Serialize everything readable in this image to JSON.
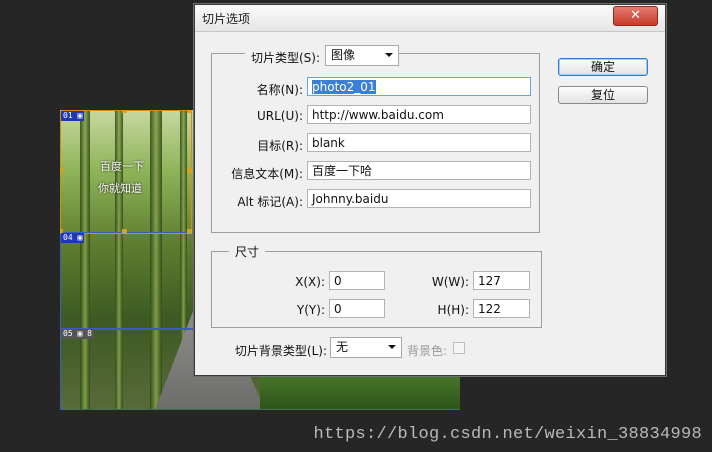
{
  "watermark": "https://blog.csdn.net/weixin_38834998",
  "canvas": {
    "slice_01": "01",
    "slice_04": "04",
    "slice_05": "05",
    "slice_05_num": "8",
    "overlay_line1": "百度一下",
    "overlay_line2": "你就知道"
  },
  "dialog": {
    "title": "切片选项",
    "close_glyph": "✕",
    "slice_type_label": "切片类型(S):",
    "slice_type_value": "图像",
    "fields": {
      "name": {
        "label": "名称(N):",
        "value": "photo2_01"
      },
      "url": {
        "label": "URL(U):",
        "value": "http://www.baidu.com"
      },
      "target": {
        "label": "目标(R):",
        "value": "blank"
      },
      "message": {
        "label": "信息文本(M):",
        "value": "百度一下哈"
      },
      "alt": {
        "label": "Alt 标记(A):",
        "value": "Johnny.baidu"
      }
    },
    "dimensions": {
      "legend": "尺寸",
      "x": {
        "label": "X(X):",
        "value": "0"
      },
      "y": {
        "label": "Y(Y):",
        "value": "0"
      },
      "w": {
        "label": "W(W):",
        "value": "127"
      },
      "h": {
        "label": "H(H):",
        "value": "122"
      }
    },
    "background": {
      "type_label": "切片背景类型(L):",
      "type_value": "无",
      "color_label": "背景色:"
    },
    "buttons": {
      "ok": "确定",
      "reset": "复位"
    }
  },
  "colors": {
    "accent": "#3c7fd6",
    "close": "#c73b2b",
    "slice_orange": "#d68a1a",
    "slice_blue": "#1e38b4"
  }
}
